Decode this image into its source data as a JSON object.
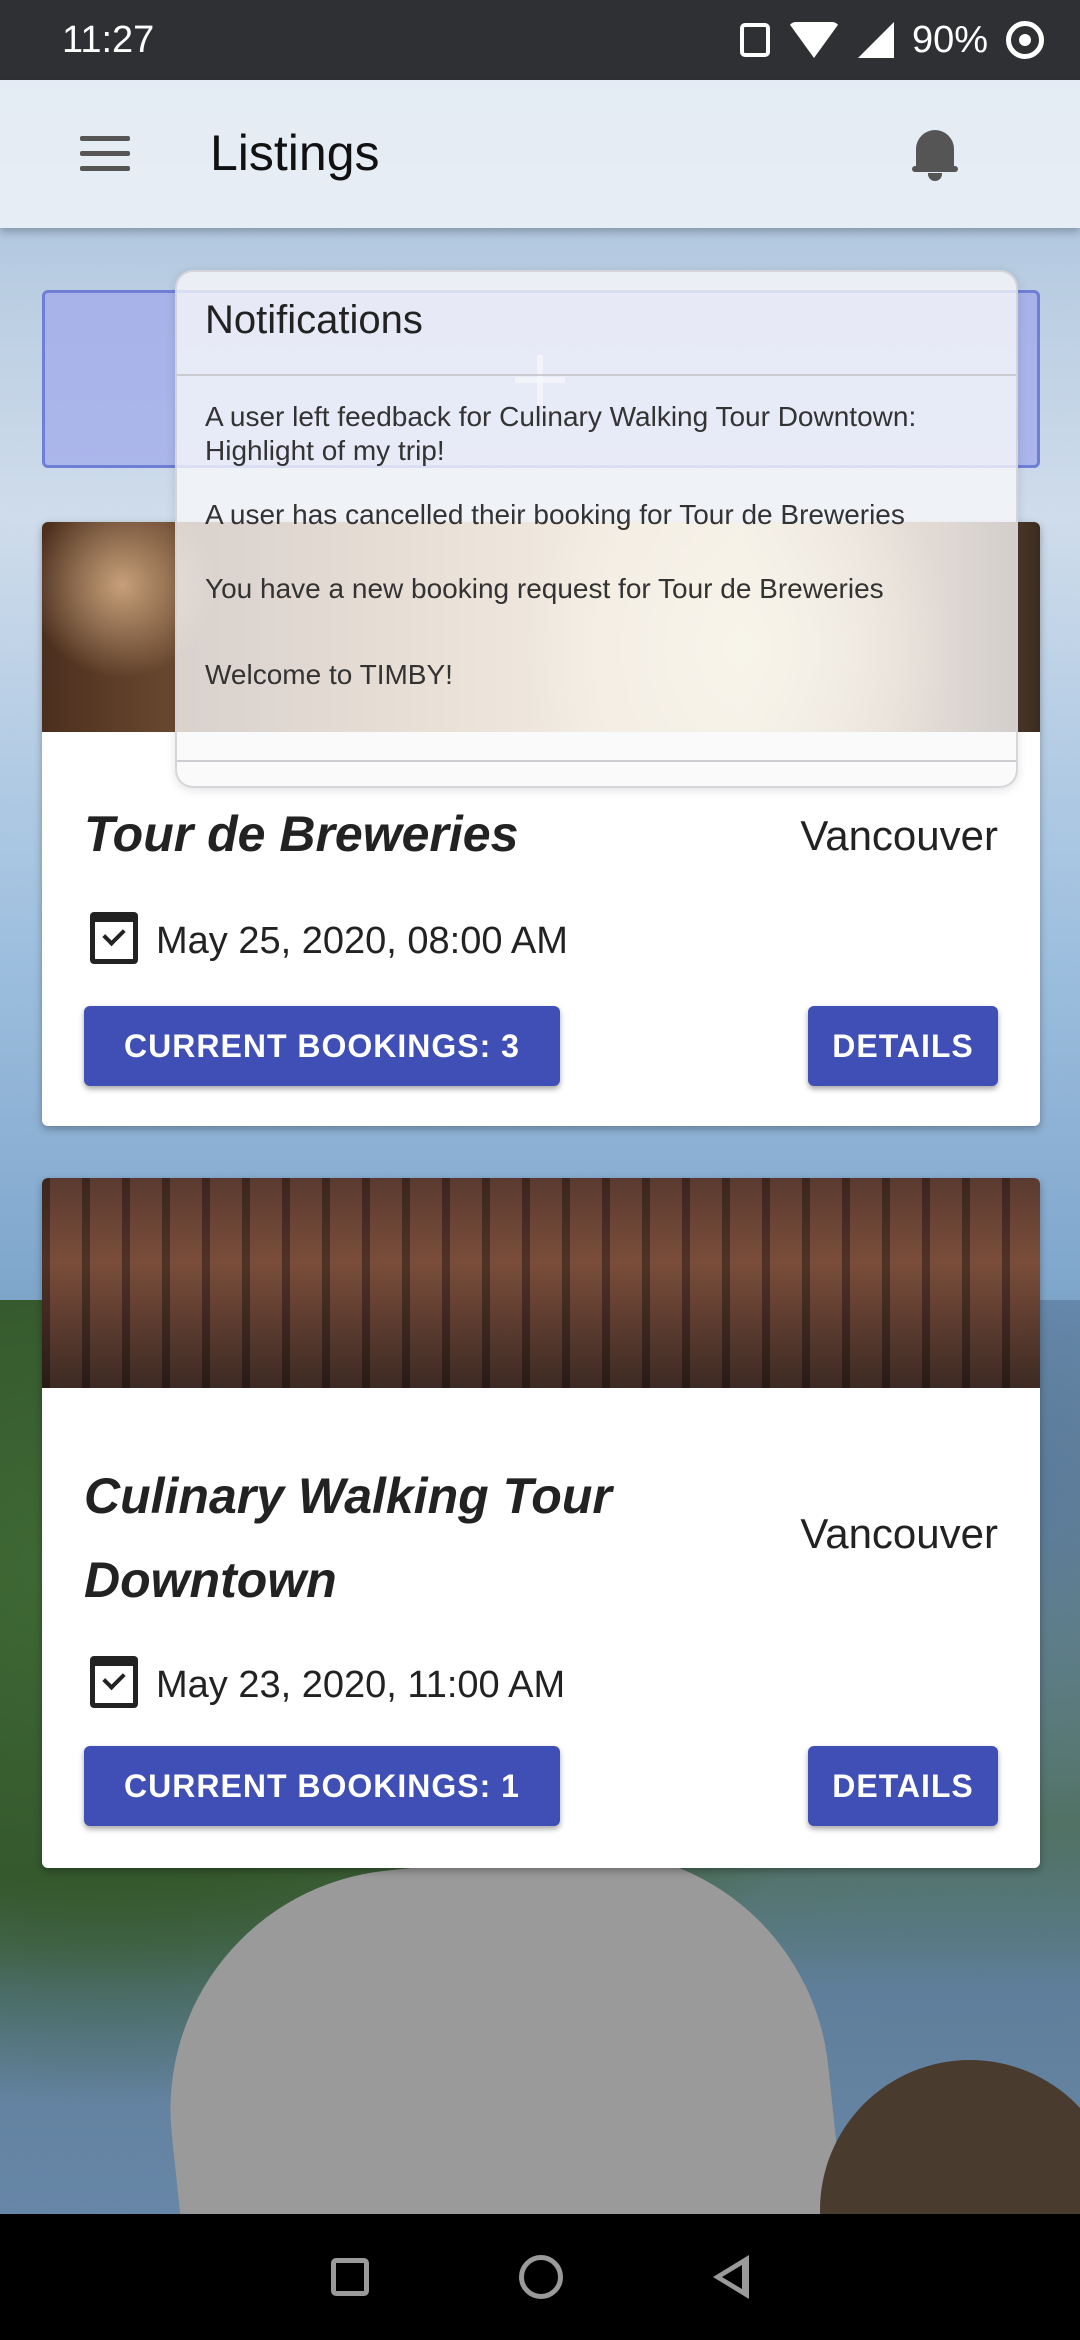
{
  "status_bar": {
    "time": "11:27",
    "battery": "90%",
    "icons": [
      "vibrate-icon",
      "wifi-icon",
      "signal-icon",
      "sync-icon"
    ]
  },
  "app_bar": {
    "title": "Listings",
    "menu_icon": "menu-icon",
    "notifications_icon": "bell-icon"
  },
  "notifications": {
    "header": "Notifications",
    "items": [
      "A user left feedback for Culinary Walking Tour Downtown: Highlight of my trip!",
      "A user has cancelled their booking for Tour de Breweries",
      "You have a new booking request for Tour de Breweries",
      "Welcome to TIMBY!"
    ]
  },
  "listings": [
    {
      "title": "Tour de Breweries",
      "city": "Vancouver",
      "date": "May 25, 2020, 08:00 AM",
      "bookings_label": "CURRENT BOOKINGS: 3",
      "details_label": "DETAILS"
    },
    {
      "title": "Culinary Walking Tour Downtown",
      "city": "Vancouver",
      "date": "May 23, 2020, 11:00 AM",
      "bookings_label": "CURRENT BOOKINGS: 1",
      "details_label": "DETAILS"
    }
  ],
  "colors": {
    "primary": "#3f4fb6",
    "status_bar": "#2f3033"
  }
}
